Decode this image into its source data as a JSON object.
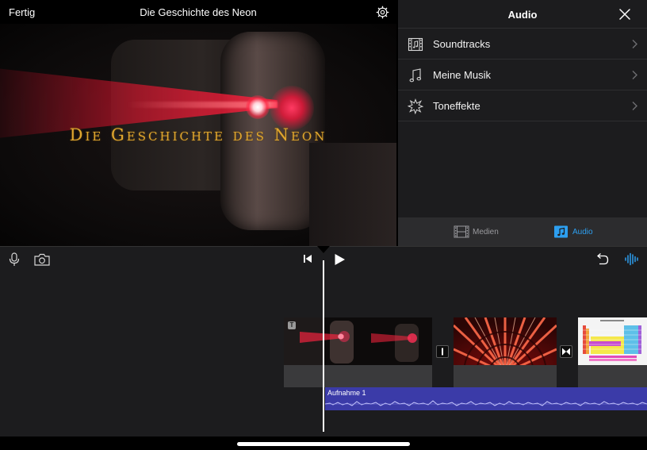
{
  "viewer": {
    "done_label": "Fertig",
    "project_title": "Die Geschichte des Neon",
    "video_title_text": "Die Geschichte des Neon"
  },
  "audio_panel": {
    "title": "Audio",
    "items": [
      {
        "label": "Soundtracks",
        "icon": "film-music-icon"
      },
      {
        "label": "Meine Musik",
        "icon": "music-note-icon"
      },
      {
        "label": "Toneffekte",
        "icon": "sound-effects-icon"
      }
    ],
    "tabs": [
      {
        "label": "Medien",
        "icon": "film-icon",
        "active": false
      },
      {
        "label": "Audio",
        "icon": "music-note-icon",
        "active": true
      }
    ],
    "accent_color": "#2d9ff0"
  },
  "timeline": {
    "title_badge": "T",
    "audio_clip_label": "Aufnahme 1",
    "audio_clip_color": "#3b3ba8"
  }
}
